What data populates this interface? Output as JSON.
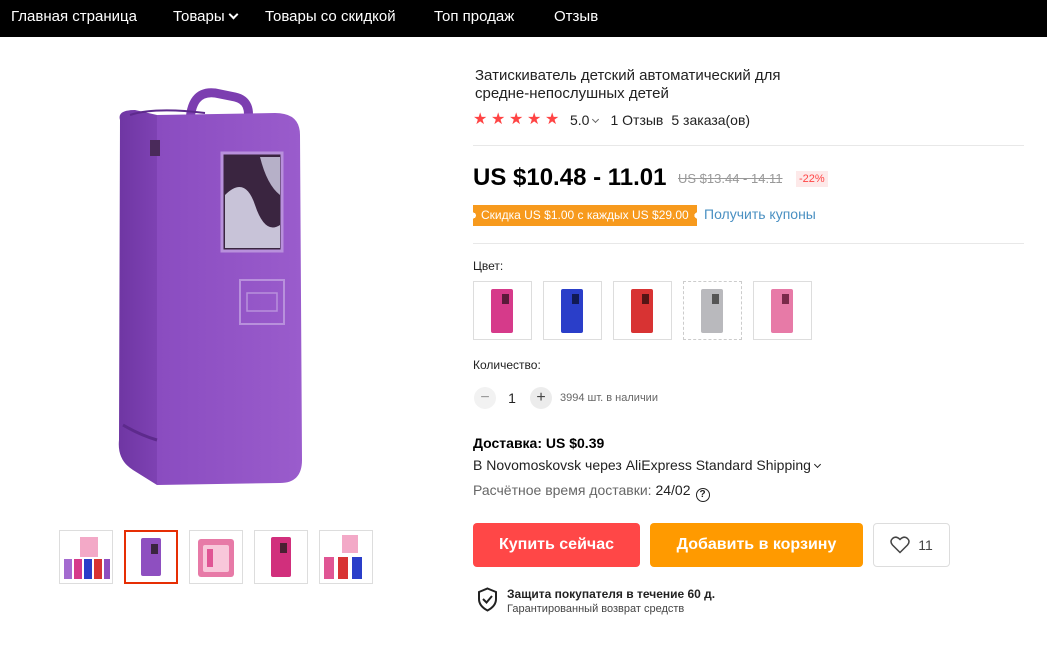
{
  "nav": {
    "items": [
      {
        "label": "Главная страница"
      },
      {
        "label": "Товары",
        "has_dropdown": true
      },
      {
        "label": "Товары со скидкой"
      },
      {
        "label": "Топ продаж"
      },
      {
        "label": "Отзыв"
      }
    ]
  },
  "product": {
    "title": "Затискиватель детский автоматический для средне-непослушных детей",
    "rating": {
      "stars": 5,
      "value": "5.0",
      "reviews": "1 Отзыв",
      "orders": "5 заказа(ов)"
    },
    "price": "US $10.48 - 11.01",
    "old_price": "US $13.44 - 14.11",
    "discount": "-22%",
    "coupon": {
      "badge": "Скидка US $1.00 с каждых US $29.00",
      "link": "Получить купоны"
    },
    "color": {
      "label": "Цвет:",
      "options": [
        {
          "color": "#d63a8a",
          "name": "pink-bag"
        },
        {
          "color": "#2a3ec9",
          "name": "blue-bag"
        },
        {
          "color": "#d83333",
          "name": "red-bag"
        },
        {
          "color": "#b9b9bd",
          "name": "grey-bag"
        },
        {
          "color": "#e77aa7",
          "name": "light-pink-bag"
        }
      ]
    },
    "quantity": {
      "label": "Количество:",
      "value": "1",
      "stock": "3994 шт. в наличии"
    },
    "shipping": {
      "title": "Доставка: US $0.39",
      "route": "В Novomoskovsk через AliExpress Standard Shipping",
      "delivery_label": "Расчётное время доставки:",
      "delivery_date": "24/02"
    },
    "buttons": {
      "buy": "Купить сейчас",
      "cart": "Добавить в корзину",
      "wishlist_count": "11"
    },
    "protection": {
      "title": "Защита покупателя в течение 60 д.",
      "subtitle": "Гарантированный возврат средств"
    }
  },
  "gallery": {
    "main_color": "#8e4fc0",
    "thumbs": [
      {
        "name": "thumb-multi-color"
      },
      {
        "name": "thumb-purple",
        "active": true
      },
      {
        "name": "thumb-pink-open"
      },
      {
        "name": "thumb-magenta"
      },
      {
        "name": "thumb-assorted"
      }
    ]
  },
  "colors": {
    "accent_red": "#ff4747",
    "accent_orange": "#ff9a00",
    "star": "#ff4444"
  }
}
